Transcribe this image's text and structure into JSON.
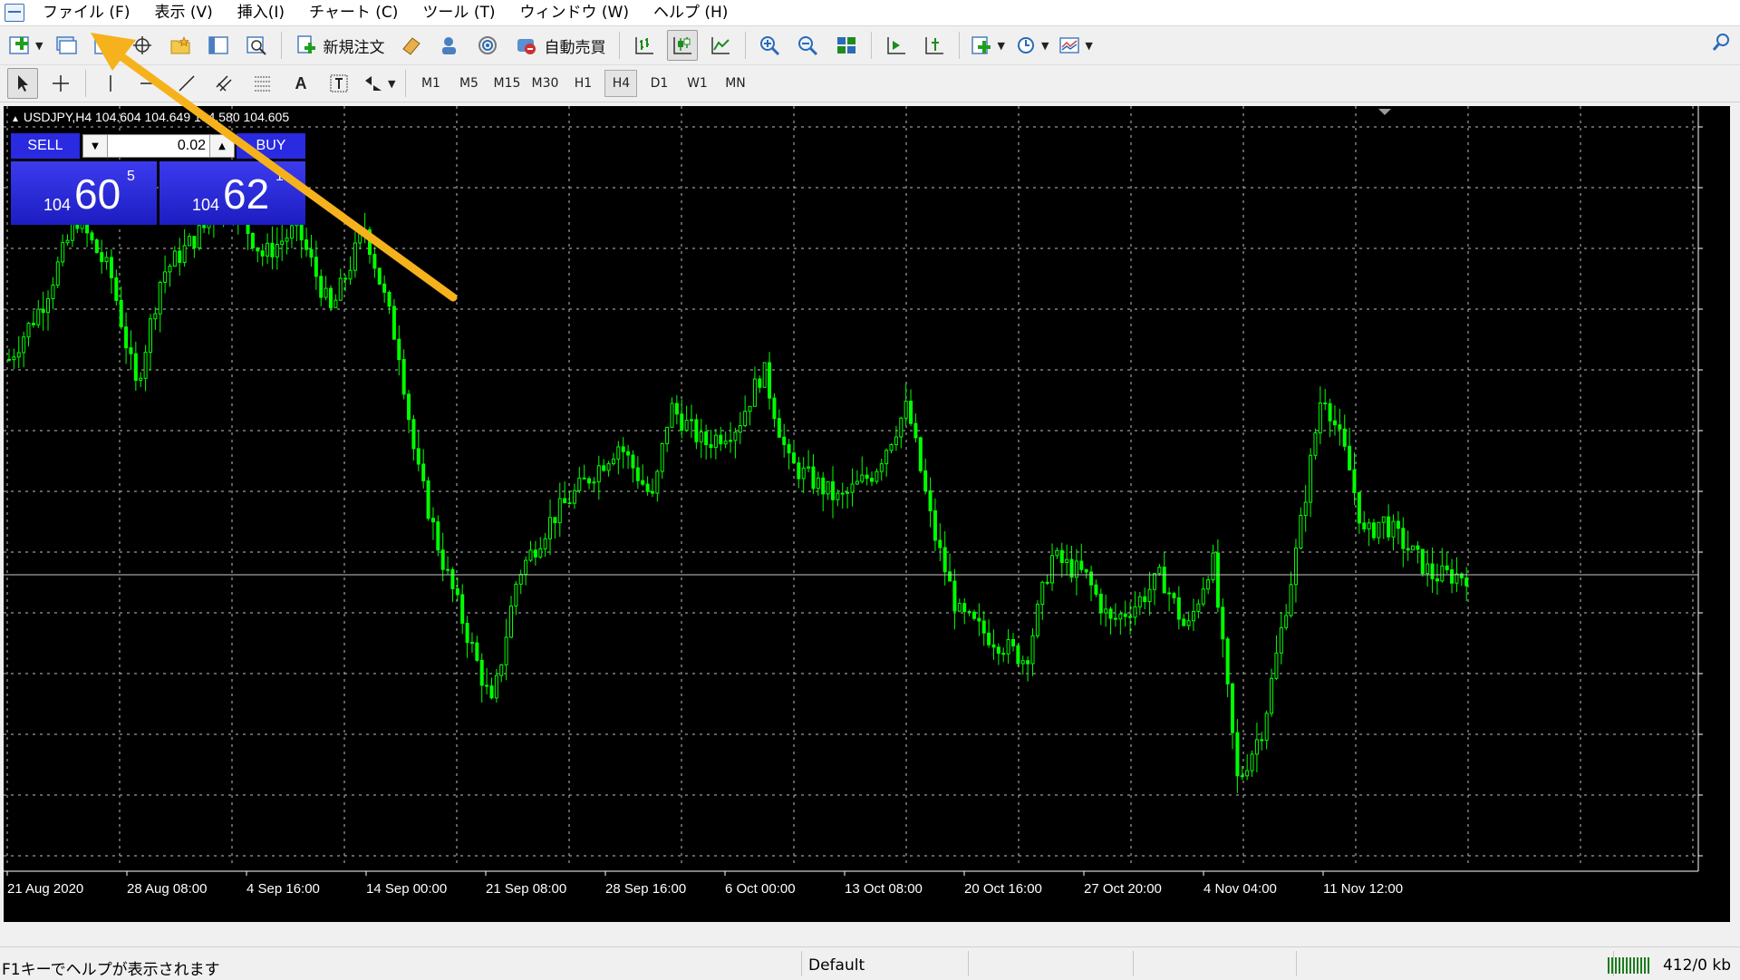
{
  "menu": {
    "items": [
      "ファイル (F)",
      "表示 (V)",
      "挿入(I)",
      "チャート (C)",
      "ツール (T)",
      "ウィンドウ (W)",
      "ヘルプ (H)"
    ]
  },
  "toolbar": {
    "new_order_label": "新規注文",
    "autotrading_label": "自動売買"
  },
  "timeframes": [
    "M1",
    "M5",
    "M15",
    "M30",
    "H1",
    "H4",
    "D1",
    "W1",
    "MN"
  ],
  "active_timeframe": "H4",
  "chart": {
    "header": "USDJPY,H4  104.604 104.649 104.580 104.605",
    "candle_color": "#00ff00",
    "background": "#000000",
    "grid_color": "#bfbfbf",
    "bid_line_value": 104.605
  },
  "one_click": {
    "sell_label": "SELL",
    "buy_label": "BUY",
    "volume": "0.02",
    "sell_price_prefix": "104",
    "sell_price_main": "60",
    "sell_price_sup": "5",
    "buy_price_prefix": "104",
    "buy_price_main": "62",
    "buy_price_sup": "1"
  },
  "chart_data": {
    "type": "candlestick",
    "symbol": "USDJPY",
    "timeframe": "H4",
    "x_labels": [
      "21 Aug 2020",
      "28 Aug 08:00",
      "4 Sep 16:00",
      "14 Sep 00:00",
      "21 Sep 08:00",
      "28 Sep 16:00",
      "6 Oct 00:00",
      "13 Oct 08:00",
      "20 Oct 16:00",
      "27 Oct 20:00",
      "4 Nov 04:00",
      "11 Nov 12:00"
    ],
    "price_path": [
      [
        0,
        105.75
      ],
      [
        0.02,
        106.05
      ],
      [
        0.04,
        106.5
      ],
      [
        0.06,
        106.2
      ],
      [
        0.075,
        105.6
      ],
      [
        0.09,
        106.2
      ],
      [
        0.11,
        106.4
      ],
      [
        0.13,
        106.6
      ],
      [
        0.15,
        106.3
      ],
      [
        0.17,
        106.45
      ],
      [
        0.19,
        106.0
      ],
      [
        0.21,
        106.45
      ],
      [
        0.23,
        105.8
      ],
      [
        0.24,
        105.2
      ],
      [
        0.255,
        104.7
      ],
      [
        0.27,
        104.3
      ],
      [
        0.285,
        103.9
      ],
      [
        0.3,
        104.6
      ],
      [
        0.32,
        104.9
      ],
      [
        0.34,
        105.1
      ],
      [
        0.36,
        105.3
      ],
      [
        0.38,
        105.0
      ],
      [
        0.39,
        105.5
      ],
      [
        0.41,
        105.3
      ],
      [
        0.43,
        105.4
      ],
      [
        0.445,
        105.7
      ],
      [
        0.46,
        105.2
      ],
      [
        0.475,
        105.1
      ],
      [
        0.49,
        105.0
      ],
      [
        0.51,
        105.15
      ],
      [
        0.53,
        105.5
      ],
      [
        0.545,
        104.85
      ],
      [
        0.56,
        104.4
      ],
      [
        0.575,
        104.3
      ],
      [
        0.6,
        104.15
      ],
      [
        0.615,
        104.7
      ],
      [
        0.635,
        104.6
      ],
      [
        0.65,
        104.35
      ],
      [
        0.665,
        104.45
      ],
      [
        0.68,
        104.6
      ],
      [
        0.695,
        104.3
      ],
      [
        0.71,
        104.7
      ],
      [
        0.725,
        103.5
      ],
      [
        0.74,
        103.8
      ],
      [
        0.76,
        104.75
      ],
      [
        0.775,
        105.6
      ],
      [
        0.79,
        105.2
      ],
      [
        0.8,
        104.8
      ],
      [
        0.81,
        104.9
      ],
      [
        0.825,
        104.75
      ],
      [
        0.84,
        104.6
      ],
      [
        0.86,
        104.605
      ]
    ],
    "y_range": [
      103.0,
      107.0
    ]
  },
  "status": {
    "help": "F1キーでヘルプが表示されます",
    "profile": "Default",
    "traffic": "412/0 kb"
  },
  "annotation": {
    "arrow_color": "#f5b21c"
  }
}
